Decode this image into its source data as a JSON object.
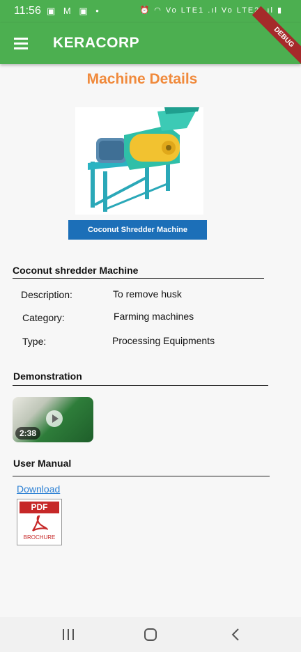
{
  "status_bar": {
    "time": "11:56",
    "left_icons": "▣ M ▣ •",
    "right_icons": "⏰ ◠ Vo LTE1 .ıl Vo LTE2 .ıl ▮"
  },
  "app_bar": {
    "title": "KERACORP",
    "debug_label": "DEBUG"
  },
  "page": {
    "title": "Machine Details",
    "image_label": "Coconut Shredder Machine",
    "machine_name": "Coconut shredder Machine",
    "details": [
      {
        "key": "Description:",
        "value": "To remove husk"
      },
      {
        "key": "Category:",
        "value": "Farming machines"
      },
      {
        "key": "Type:",
        "value": "Processing Equipments"
      }
    ],
    "demonstration": {
      "heading": "Demonstration",
      "duration": "2:38"
    },
    "user_manual": {
      "heading": "User Manual",
      "download_label": "Download",
      "pdf_label": "PDF",
      "brochure_label": "BROCHURE"
    }
  },
  "colors": {
    "primary": "#4caf50",
    "title_orange": "#f08a3c",
    "link_blue": "#2a7fd4"
  }
}
